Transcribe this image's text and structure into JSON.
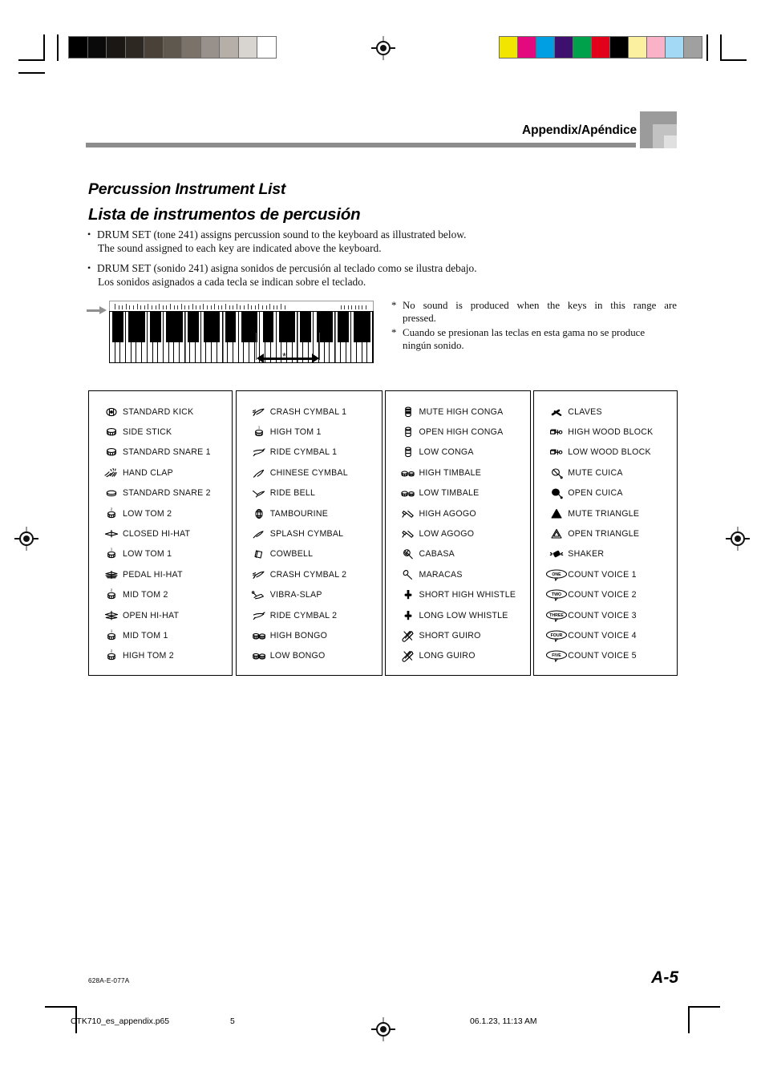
{
  "header": {
    "title": "Appendix/Apéndice"
  },
  "titles": {
    "en": "Percussion Instrument List",
    "es": "Lista de instrumentos de percusión"
  },
  "bullets": [
    {
      "line1": "DRUM SET (tone 241) assigns percussion sound to the keyboard as illustrated below.",
      "line2": "The sound assigned to each key are indicated above the keyboard."
    },
    {
      "line1": "DRUM SET (sonido 241) asigna sonidos de percusión al teclado como se ilustra debajo.",
      "line2": "Los sonidos asignados a cada tecla se indican sobre el teclado."
    }
  ],
  "figure": {
    "range_marker": "*"
  },
  "notes": [
    {
      "marker": "*",
      "line1": "No sound is produced when the keys in this range are",
      "line2": "pressed."
    },
    {
      "marker": "*",
      "line1": "Cuando se presionan las teclas en esta gama no se produce",
      "line2": "ningún sonido."
    }
  ],
  "table": {
    "columns": [
      {
        "items": [
          {
            "icon": "bass-drum-icon",
            "label": "STANDARD KICK"
          },
          {
            "icon": "snare-drum-icon",
            "label": "SIDE STICK"
          },
          {
            "icon": "snare-drum-icon",
            "label": "STANDARD SNARE 1"
          },
          {
            "icon": "hand-clap-icon",
            "label": "HAND CLAP"
          },
          {
            "icon": "snare-drum-flat-icon",
            "label": "STANDARD SNARE 2"
          },
          {
            "icon": "tom-2-icon",
            "label": "LOW TOM 2"
          },
          {
            "icon": "hi-hat-closed-icon",
            "label": "CLOSED HI-HAT"
          },
          {
            "icon": "tom-1-icon",
            "label": "LOW TOM 1"
          },
          {
            "icon": "hi-hat-pedal-icon",
            "label": "PEDAL HI-HAT"
          },
          {
            "icon": "tom-2-icon",
            "label": "MID TOM 2"
          },
          {
            "icon": "hi-hat-open-icon",
            "label": "OPEN HI-HAT"
          },
          {
            "icon": "tom-1-icon",
            "label": "MID TOM 1"
          },
          {
            "icon": "tom-2-icon",
            "label": "HIGH TOM 2"
          }
        ]
      },
      {
        "items": [
          {
            "icon": "crash-cymbal-icon",
            "label": "CRASH CYMBAL 1"
          },
          {
            "icon": "tom-1-icon",
            "label": "HIGH TOM 1"
          },
          {
            "icon": "ride-cymbal-icon",
            "label": "RIDE CYMBAL 1"
          },
          {
            "icon": "chinese-cymbal-icon",
            "label": "CHINESE CYMBAL"
          },
          {
            "icon": "ride-bell-icon",
            "label": "RIDE BELL"
          },
          {
            "icon": "tambourine-icon",
            "label": "TAMBOURINE"
          },
          {
            "icon": "splash-cymbal-icon",
            "label": "SPLASH CYMBAL"
          },
          {
            "icon": "cowbell-icon",
            "label": "COWBELL"
          },
          {
            "icon": "crash-cymbal-icon",
            "label": "CRASH CYMBAL 2"
          },
          {
            "icon": "vibra-slap-icon",
            "label": "VIBRA-SLAP"
          },
          {
            "icon": "ride-cymbal-icon",
            "label": "RIDE CYMBAL 2"
          },
          {
            "icon": "bongo-icon",
            "label": "HIGH BONGO"
          },
          {
            "icon": "bongo-icon",
            "label": "LOW BONGO"
          }
        ]
      },
      {
        "items": [
          {
            "icon": "conga-mute-icon",
            "label": "MUTE HIGH CONGA"
          },
          {
            "icon": "conga-open-icon",
            "label": "OPEN HIGH CONGA"
          },
          {
            "icon": "conga-open-icon",
            "label": "LOW CONGA"
          },
          {
            "icon": "timbale-icon",
            "label": "HIGH TIMBALE"
          },
          {
            "icon": "timbale-icon",
            "label": "LOW TIMBALE"
          },
          {
            "icon": "agogo-icon",
            "label": "HIGH AGOGO"
          },
          {
            "icon": "agogo-icon",
            "label": "LOW AGOGO"
          },
          {
            "icon": "cabasa-icon",
            "label": "CABASA"
          },
          {
            "icon": "maracas-icon",
            "label": "MARACAS"
          },
          {
            "icon": "whistle-icon",
            "label": "SHORT HIGH WHISTLE"
          },
          {
            "icon": "whistle-icon",
            "label": "LONG LOW WHISTLE"
          },
          {
            "icon": "guiro-icon",
            "label": "SHORT GUIRO"
          },
          {
            "icon": "guiro-icon",
            "label": "LONG GUIRO"
          }
        ]
      },
      {
        "items": [
          {
            "icon": "claves-icon",
            "label": "CLAVES"
          },
          {
            "icon": "wood-block-icon",
            "label": "HIGH WOOD BLOCK"
          },
          {
            "icon": "wood-block-icon",
            "label": "LOW WOOD BLOCK"
          },
          {
            "icon": "cuica-mute-icon",
            "label": "MUTE CUICA"
          },
          {
            "icon": "cuica-open-icon",
            "label": "OPEN CUICA"
          },
          {
            "icon": "triangle-mute-icon",
            "label": "MUTE TRIANGLE"
          },
          {
            "icon": "triangle-open-icon",
            "label": "OPEN TRIANGLE"
          },
          {
            "icon": "shaker-icon",
            "label": "SHAKER"
          },
          {
            "icon": "count-voice-icon",
            "bubble": "ONE",
            "label": "COUNT VOICE 1"
          },
          {
            "icon": "count-voice-icon",
            "bubble": "TWO",
            "label": "COUNT VOICE 2"
          },
          {
            "icon": "count-voice-icon",
            "bubble": "THREE",
            "label": "COUNT VOICE 3"
          },
          {
            "icon": "count-voice-icon",
            "bubble": "FOUR",
            "label": "COUNT VOICE 4"
          },
          {
            "icon": "count-voice-icon",
            "bubble": "FIVE",
            "label": "COUNT VOICE 5"
          }
        ]
      }
    ]
  },
  "footer": {
    "code": "628A-E-077A",
    "page": "A-5",
    "file": "CTK710_es_appendix.p65",
    "sheet": "5",
    "timestamp": "06.1.23, 11:13 AM"
  },
  "calibration": {
    "grayscale": [
      "#000000",
      "#0a0a0a",
      "#1a1714",
      "#2e2823",
      "#4a4239",
      "#5f584f",
      "#7b736a",
      "#98908a",
      "#b6afa8",
      "#d8d4cf",
      "#ffffff"
    ],
    "colors": [
      "#f2e600",
      "#e4097e",
      "#009fe3",
      "#3d1070",
      "#00a14b",
      "#e2001a",
      "#000000",
      "#faf0a0",
      "#f9b2c8",
      "#a3d9f5",
      "#a0a0a0"
    ]
  }
}
